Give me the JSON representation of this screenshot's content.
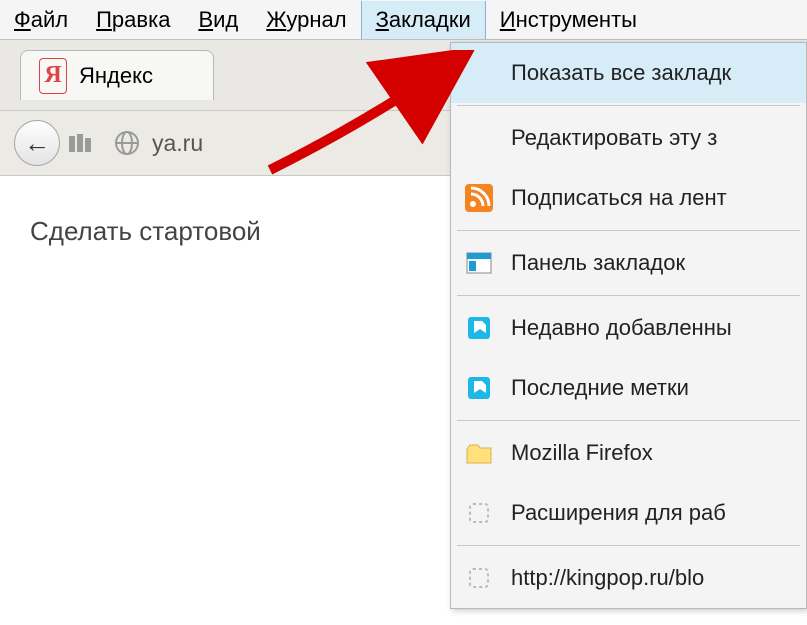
{
  "menubar": {
    "items": [
      {
        "pre": "",
        "hot": "Ф",
        "post": "айл"
      },
      {
        "pre": "",
        "hot": "П",
        "post": "равка"
      },
      {
        "pre": "",
        "hot": "В",
        "post": "ид"
      },
      {
        "pre": "",
        "hot": "Ж",
        "post": "урнал"
      },
      {
        "pre": "",
        "hot": "З",
        "post": "акладки"
      },
      {
        "pre": "",
        "hot": "И",
        "post": "нструменты"
      }
    ],
    "active_index": 4
  },
  "tab": {
    "title": "Яндекс",
    "logo_letter": "Я"
  },
  "navbar": {
    "back_glyph": "←",
    "url": "ya.ru"
  },
  "page": {
    "link_text": "Сделать стартовой"
  },
  "dropdown": {
    "items": [
      {
        "label": "Показать все закладк",
        "icon": "none"
      },
      {
        "sep": true
      },
      {
        "label": "Редактировать эту з",
        "icon": "none"
      },
      {
        "label": "Подписаться на лент",
        "icon": "rss"
      },
      {
        "sep": true
      },
      {
        "label": "Панель закладок",
        "icon": "panel"
      },
      {
        "sep": true
      },
      {
        "label": "Недавно добавленны",
        "icon": "tag"
      },
      {
        "label": "Последние метки",
        "icon": "tag"
      },
      {
        "sep": true
      },
      {
        "label": "Mozilla Firefox",
        "icon": "folder"
      },
      {
        "label": "Расширения для раб",
        "icon": "page"
      },
      {
        "sep": true
      },
      {
        "label": "http://kingpop.ru/blo",
        "icon": "page"
      }
    ]
  }
}
